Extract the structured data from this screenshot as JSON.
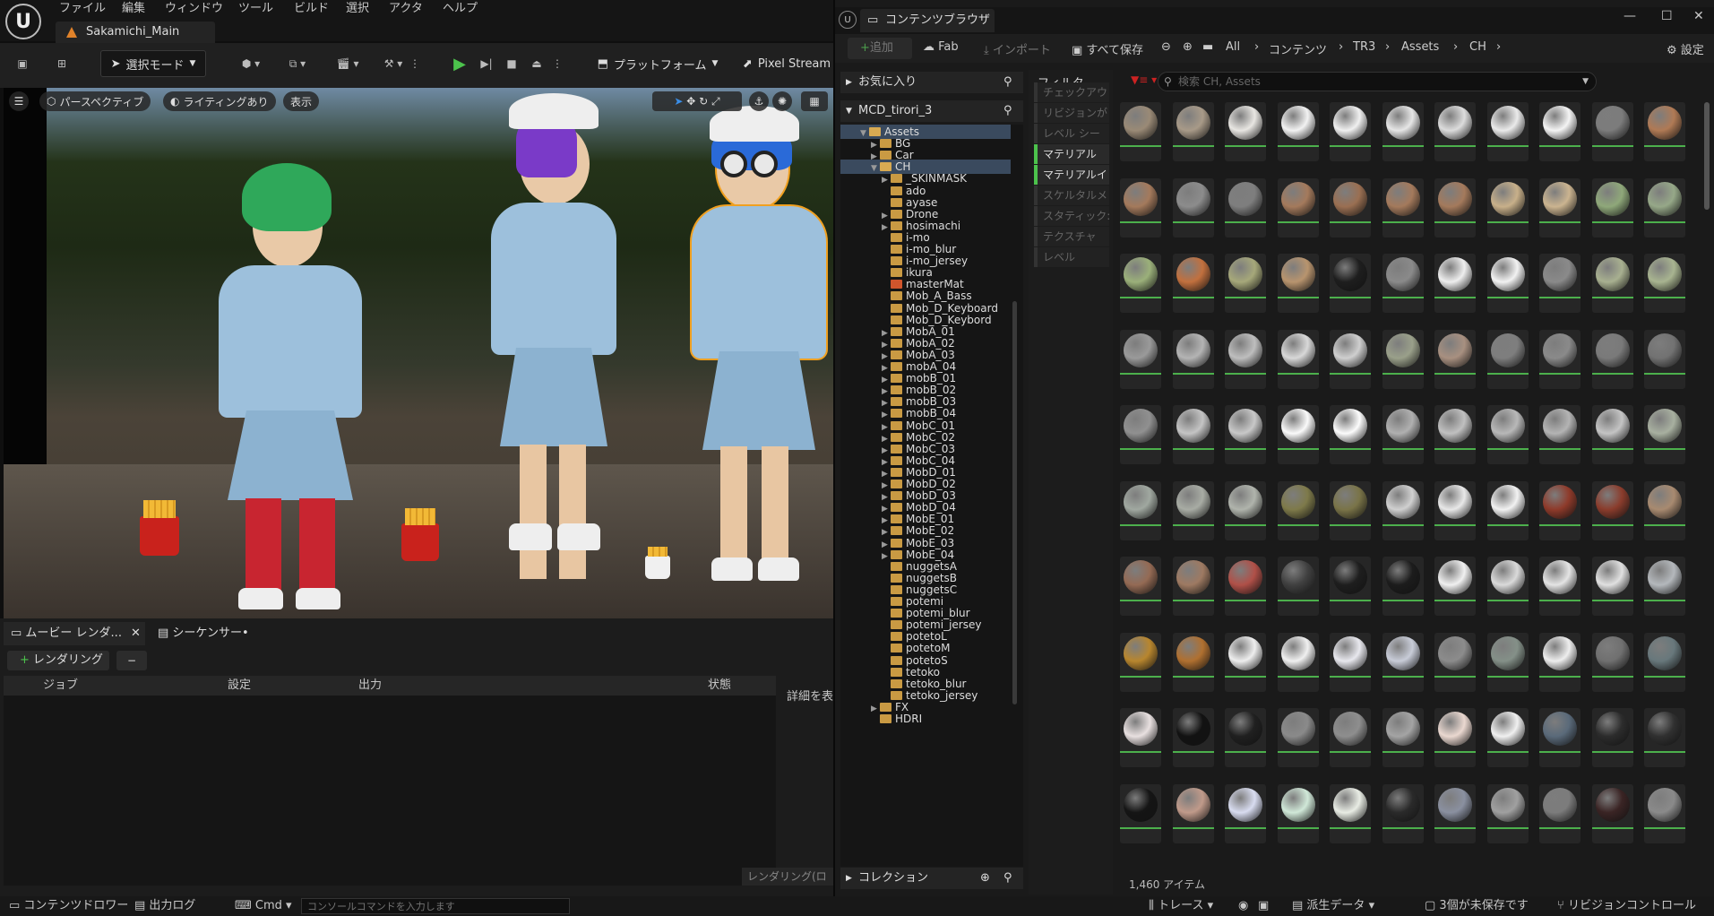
{
  "menubar": {
    "items": [
      "ファイル",
      "編集",
      "ウィンドウ",
      "ツール",
      "ビルド",
      "選択",
      "アクタ",
      "ヘルプ"
    ],
    "level_tab": "Sakamichi_Main"
  },
  "toolbar": {
    "mode": "選択モード",
    "platform": "プラットフォーム",
    "pixel_stream": "Pixel Stream"
  },
  "viewport": {
    "perspective": "パースペクティブ",
    "lighting": "ライティングあり",
    "show": "表示"
  },
  "bottom_panel": {
    "tabs": [
      "ムービー レンダ...",
      "シーケンサー•"
    ],
    "render_button": "レンダリング",
    "columns": [
      "ジョブ",
      "設定",
      "出力",
      "状態"
    ],
    "detail_text": "詳細を表",
    "render_log": "レンダリング(ロ"
  },
  "statusbar": {
    "content_drawer": "コンテンツドロワー",
    "output_log": "出力ログ",
    "cmd": "Cmd",
    "console_placeholder": "コンソールコマンドを入力します",
    "trace": "トレース",
    "derived_data": "派生データ",
    "unsaved": "3個が未保存です",
    "revision": "リビジョンコントロール"
  },
  "content_browser": {
    "title": "コンテンツブラウザ",
    "add": "追加",
    "fab": "Fab",
    "import": "インポート",
    "save_all": "すべて保存",
    "breadcrumbs": [
      "All",
      "コンテンツ",
      "TR3",
      "Assets",
      "CH"
    ],
    "settings": "設定",
    "favorites": "お気に入り",
    "project": "MCD_tirori_3",
    "collections": "コレクション",
    "filter_title": "フィルタ",
    "filters": [
      {
        "label": "チェックアウ",
        "active": false
      },
      {
        "label": "リビジョンが",
        "active": false
      },
      {
        "label": "レベル シー",
        "active": false
      },
      {
        "label": "マテリアル",
        "active": true
      },
      {
        "label": "マテリアルイ",
        "active": true
      },
      {
        "label": "スケルタルメ",
        "active": false
      },
      {
        "label": "スタティック:",
        "active": false
      },
      {
        "label": "テクスチャ",
        "active": false
      },
      {
        "label": "レベル",
        "active": false
      }
    ],
    "search_placeholder": "検索 CH, Assets",
    "item_count": "1,460 アイテム",
    "tree": [
      {
        "name": "Assets",
        "depth": 0,
        "open": true,
        "arrow": true,
        "sel": true
      },
      {
        "name": "BG",
        "depth": 1,
        "arrow": true
      },
      {
        "name": "Car",
        "depth": 1,
        "arrow": true
      },
      {
        "name": "CH",
        "depth": 1,
        "open": true,
        "arrow": true,
        "sel": true
      },
      {
        "name": "_SKINMASK",
        "depth": 2,
        "arrow": true
      },
      {
        "name": "ado",
        "depth": 2
      },
      {
        "name": "ayase",
        "depth": 2
      },
      {
        "name": "Drone",
        "depth": 2,
        "arrow": true
      },
      {
        "name": "hosimachi",
        "depth": 2,
        "arrow": true
      },
      {
        "name": "i-mo",
        "depth": 2
      },
      {
        "name": "i-mo_blur",
        "depth": 2
      },
      {
        "name": "i-mo_jersey",
        "depth": 2
      },
      {
        "name": "ikura",
        "depth": 2
      },
      {
        "name": "masterMat",
        "depth": 2,
        "red": true
      },
      {
        "name": "Mob_A_Bass",
        "depth": 2
      },
      {
        "name": "Mob_D_Keyboard",
        "depth": 2
      },
      {
        "name": "Mob_D_Keybord",
        "depth": 2
      },
      {
        "name": "MobA_01",
        "depth": 2,
        "arrow": true
      },
      {
        "name": "MobA_02",
        "depth": 2,
        "arrow": true
      },
      {
        "name": "MobA_03",
        "depth": 2,
        "arrow": true
      },
      {
        "name": "mobA_04",
        "depth": 2,
        "arrow": true
      },
      {
        "name": "mobB_01",
        "depth": 2,
        "arrow": true
      },
      {
        "name": "mobB_02",
        "depth": 2,
        "arrow": true
      },
      {
        "name": "mobB_03",
        "depth": 2,
        "arrow": true
      },
      {
        "name": "mobB_04",
        "depth": 2,
        "arrow": true
      },
      {
        "name": "MobC_01",
        "depth": 2,
        "arrow": true
      },
      {
        "name": "MobC_02",
        "depth": 2,
        "arrow": true
      },
      {
        "name": "MobC_03",
        "depth": 2,
        "arrow": true
      },
      {
        "name": "MobC_04",
        "depth": 2,
        "arrow": true
      },
      {
        "name": "MobD_01",
        "depth": 2,
        "arrow": true
      },
      {
        "name": "MobD_02",
        "depth": 2,
        "arrow": true
      },
      {
        "name": "MobD_03",
        "depth": 2,
        "arrow": true
      },
      {
        "name": "MobD_04",
        "depth": 2,
        "arrow": true
      },
      {
        "name": "MobE_01",
        "depth": 2,
        "arrow": true
      },
      {
        "name": "MobE_02",
        "depth": 2,
        "arrow": true
      },
      {
        "name": "MobE_03",
        "depth": 2,
        "arrow": true
      },
      {
        "name": "MobE_04",
        "depth": 2,
        "arrow": true
      },
      {
        "name": "nuggetsA",
        "depth": 2
      },
      {
        "name": "nuggetsB",
        "depth": 2
      },
      {
        "name": "nuggetsC",
        "depth": 2
      },
      {
        "name": "potemi",
        "depth": 2
      },
      {
        "name": "potemi_blur",
        "depth": 2
      },
      {
        "name": "potemi_jersey",
        "depth": 2
      },
      {
        "name": "potetoL",
        "depth": 2
      },
      {
        "name": "potetoM",
        "depth": 2
      },
      {
        "name": "potetoS",
        "depth": 2
      },
      {
        "name": "tetoko",
        "depth": 2
      },
      {
        "name": "tetoko_blur",
        "depth": 2
      },
      {
        "name": "tetoko_jersey",
        "depth": 2
      },
      {
        "name": "FX",
        "depth": 1,
        "arrow": true
      },
      {
        "name": "HDRI",
        "depth": 1
      }
    ],
    "thumbnails": [
      [
        "#9a8a76",
        "#a89a88",
        "#e8e6e2",
        "#f2f2f2",
        "#f0f0f0",
        "#e6e6e6",
        "#dcdcdc",
        "#eaeaea",
        "#f4f4f4",
        "#7c7c7c",
        "#b07a55"
      ],
      [
        "#a47a5c",
        "#8c8c8c",
        "#7e7e7e",
        "#a47a5c",
        "#9a6f52",
        "#a47a5c",
        "#a47a5c",
        "#c8b08a",
        "#cbb490",
        "#8fa87a",
        "#96a888"
      ],
      [
        "#9bb07a",
        "#c2703e",
        "#a6a87a",
        "#b8946e",
        "#1e1e1e",
        "#8a8a8a",
        "#eeeeee",
        "#f2f2f2",
        "#8a8a8a",
        "#a8b090",
        "#a8b490"
      ],
      [
        "#9a9a9a",
        "#b4b4b4",
        "#bebebe",
        "#d8d8d8",
        "#cfcfcf",
        "#9aa08a",
        "#a89080",
        "#7e7e7e",
        "#8a8a8a",
        "#7a7a7a",
        "#727272"
      ],
      [
        "#909090",
        "#c4c4c4",
        "#c8c8c8",
        "#fafafa",
        "#fcfcfc",
        "#b0b0b0",
        "#c0c0c0",
        "#b8b8b8",
        "#b4b4b4",
        "#c4c4c4",
        "#a8b0a0"
      ],
      [
        "#a0a8a0",
        "#a8aca4",
        "#b0b4ac",
        "#7e7a4a",
        "#7a7448",
        "#d0d0d0",
        "#e8e8e8",
        "#f2f2f2",
        "#8e3a2a",
        "#8a3c2c",
        "#a88a70"
      ],
      [
        "#946a54",
        "#9e7a62",
        "#b05048",
        "#404040",
        "#1e1e1e",
        "#1c1c1c",
        "#f0f0f0",
        "#dadada",
        "#e4e4e4",
        "#e0e0e0",
        "#b4b8bc"
      ],
      [
        "#b8862e",
        "#b07030",
        "#eeeeee",
        "#f0f0f0",
        "#e8e8ee",
        "#c8ccd8",
        "#8c8c8c",
        "#849088",
        "#eeeeee",
        "#707070",
        "#68787c"
      ],
      [
        "#e8e0e0",
        "#121212",
        "#202020",
        "#8a8a8a",
        "#8e8e8e",
        "#a4a4a4",
        "#ead8d0",
        "#f0f0f0",
        "#5a6a7a",
        "#2c2c2c",
        "#303030"
      ],
      [
        "#151515",
        "#c09a8a",
        "#d8dcf0",
        "#d0e8d8",
        "#e8ece4",
        "#2a2a2a",
        "#8a90a0",
        "#a0a0a0",
        "#7c7c7c",
        "#3a2424",
        "#8a8a8a"
      ]
    ]
  }
}
